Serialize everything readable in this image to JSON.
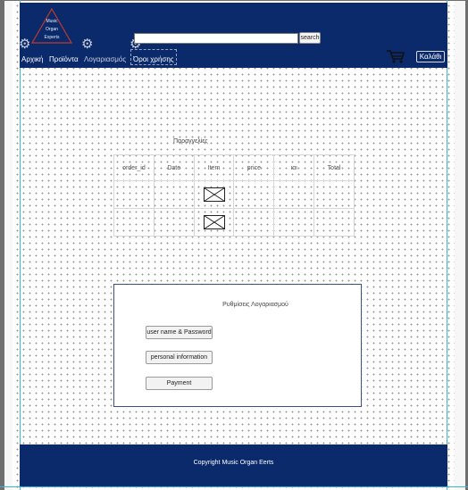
{
  "header": {
    "logo_lines": [
      "Music",
      "Organ",
      "Experts"
    ],
    "search": {
      "value": "",
      "button_label": "search"
    },
    "nav": [
      {
        "label": "Αρχική"
      },
      {
        "label": "Προϊόντα"
      },
      {
        "label": "Λογαριασμός"
      },
      {
        "label": "Όροι χρήσης"
      }
    ],
    "cart_icon": "shopping-cart-icon",
    "login_label": "Καλάθι"
  },
  "orders": {
    "title": "Παραγγελίες",
    "columns": [
      "order_id",
      "Date",
      "Item",
      "price",
      "ιαι",
      "Total"
    ],
    "rows": [
      [
        "",
        "",
        "image-placeholder",
        "",
        "",
        ""
      ],
      [
        "",
        "",
        "image-placeholder",
        "",
        "",
        ""
      ]
    ]
  },
  "settings": {
    "title": "Ρυθμίσεις Λογαριασμού",
    "buttons": [
      "user name & Password",
      "personal information",
      "Payment"
    ]
  },
  "footer": {
    "text": "Copyright Music Organ Eerts"
  },
  "colors": {
    "header_bg": "#0a2a6b",
    "footer_bg": "#0a2a6b",
    "guide": "#37b6d9"
  }
}
